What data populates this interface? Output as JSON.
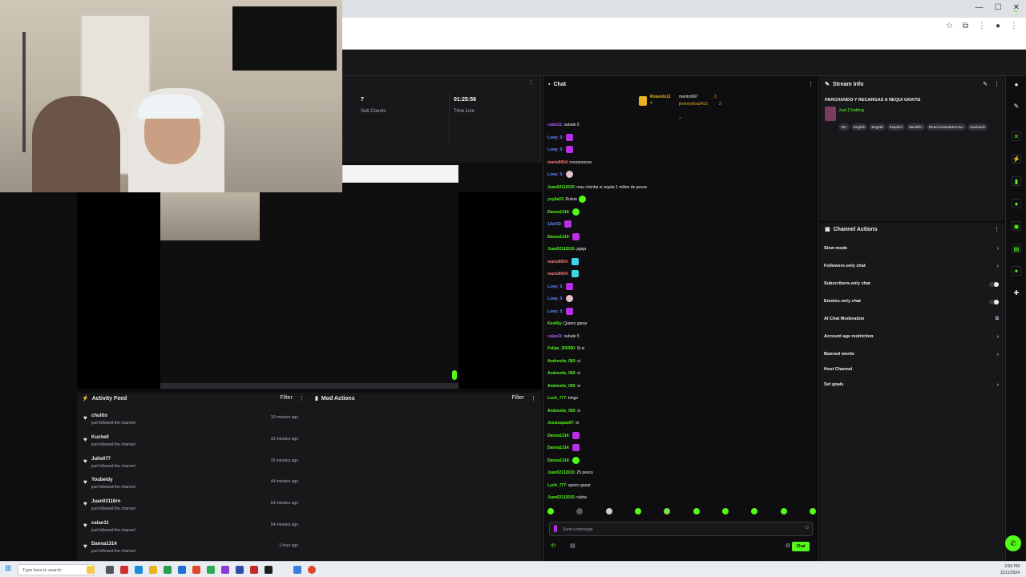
{
  "browser": {
    "window_controls": [
      "—",
      "☐",
      "✕"
    ]
  },
  "stats": {
    "sub_count_value": "7",
    "sub_count_label": "Sub Counts",
    "time_live_value": "01:25:56",
    "time_live_label": "Time Live"
  },
  "activity": {
    "title": "Activity Feed",
    "filter": "Filter",
    "items": [
      {
        "user": "chuitto",
        "desc": "just followed the channel",
        "time": "10 minutes ago"
      },
      {
        "user": "Kuchell",
        "desc": "just followed the channel",
        "time": "33 minutes ago"
      },
      {
        "user": "Julio077",
        "desc": "just followed the channel",
        "time": "35 minutes ago"
      },
      {
        "user": "Youbeidy",
        "desc": "just followed the channel",
        "time": "44 minutes ago"
      },
      {
        "user": "Juan03116rn",
        "desc": "just followed the channel",
        "time": "53 minutes ago"
      },
      {
        "user": "calao11",
        "desc": "just followed the channel",
        "time": "54 minutes ago"
      },
      {
        "user": "Danna1314",
        "desc": "just followed the channel",
        "time": "1 hour ago"
      }
    ]
  },
  "mod_actions": {
    "title": "Mod Actions",
    "filter": "Filter"
  },
  "chat": {
    "title": "Chat",
    "pinned": [
      {
        "user": "Rolando12",
        "count": "4",
        "user2": "mantro967",
        "n2": "3"
      },
      {
        "user2": "jhonnysilva2415",
        "n2": "2"
      }
    ],
    "messages": [
      {
        "user": "calao11",
        "color": "#b45cff",
        "msg": "subale 5",
        "emote": ""
      },
      {
        "user": "Lowy_5",
        "color": "#5b8cff",
        "msg": "",
        "emote": "purple"
      },
      {
        "user": "Lowy_5",
        "color": "#5b8cff",
        "msg": "",
        "emote": "purple"
      },
      {
        "user": "mario8054",
        "color": "#ff7a7a",
        "msg": "nooooooooo",
        "emote": ""
      },
      {
        "user": "Lowy_5",
        "color": "#5b8cff",
        "msg": "",
        "emote": "face"
      },
      {
        "user": "Juan02112015",
        "color": "#53fc18",
        "msg": "mas chimba si regala 1 millon de pesos",
        "emote": ""
      },
      {
        "user": "yoyila03",
        "color": "#53fc18",
        "msg": "Rulete",
        "emote": "green"
      },
      {
        "user": "Danna1314",
        "color": "#53fc18",
        "msg": "",
        "emote": "green"
      },
      {
        "user": "12e032",
        "color": "#5b8cff",
        "msg": "",
        "emote": "purple"
      },
      {
        "user": "Danna1314",
        "color": "#53fc18",
        "msg": "",
        "emote": "purple"
      },
      {
        "user": "Juan02112015",
        "color": "#53fc18",
        "msg": "jajaja",
        "emote": ""
      },
      {
        "user": "mario8054",
        "color": "#ff7a7a",
        "msg": "",
        "emote": "cyan"
      },
      {
        "user": "mario8054",
        "color": "#ff7a7a",
        "msg": "",
        "emote": "cyan"
      },
      {
        "user": "Lowy_5",
        "color": "#5b8cff",
        "msg": "",
        "emote": "purple"
      },
      {
        "user": "Lowy_5",
        "color": "#5b8cff",
        "msg": "",
        "emote": "face"
      },
      {
        "user": "Lowy_5",
        "color": "#5b8cff",
        "msg": "",
        "emote": "purple"
      },
      {
        "user": "Kev66y",
        "color": "#53fc18",
        "msg": "Quiero ganar",
        "emote": ""
      },
      {
        "user": "calao11",
        "color": "#b45cff",
        "msg": "subale 5",
        "emote": ""
      },
      {
        "user": "Felipe_305060",
        "color": "#53fc18",
        "msg": "Si si",
        "emote": ""
      },
      {
        "user": "Andresito_060",
        "color": "#53fc18",
        "msg": "si",
        "emote": ""
      },
      {
        "user": "Andresito_060",
        "color": "#53fc18",
        "msg": "si",
        "emote": ""
      },
      {
        "user": "Andresito_060",
        "color": "#53fc18",
        "msg": "si",
        "emote": ""
      },
      {
        "user": "Luch_777",
        "color": "#53fc18",
        "msg": "bingo",
        "emote": ""
      },
      {
        "user": "Andresito_060",
        "color": "#53fc18",
        "msg": "si",
        "emote": ""
      },
      {
        "user": "Jessicapao07",
        "color": "#53fc18",
        "msg": "si",
        "emote": ""
      },
      {
        "user": "Danna1314",
        "color": "#53fc18",
        "msg": "",
        "emote": "purple"
      },
      {
        "user": "Danna1314",
        "color": "#53fc18",
        "msg": "",
        "emote": "purple"
      },
      {
        "user": "Danna1314",
        "color": "#53fc18",
        "msg": "",
        "emote": "green"
      },
      {
        "user": "Juan02112015",
        "color": "#53fc18",
        "msg": "25 pesos",
        "emote": ""
      },
      {
        "user": "Luch_777",
        "color": "#53fc18",
        "msg": "quiero ganar",
        "emote": ""
      },
      {
        "user": "Juan02112015",
        "color": "#53fc18",
        "msg": "ruleta",
        "emote": ""
      }
    ],
    "input_placeholder": "Send a message",
    "send_label": "Chat"
  },
  "stream_info": {
    "title": "Stream Info",
    "stream_title": "PARCHANDO Y RECARGAS A NEQUI GRATIS",
    "category": "Just Chatting",
    "tags": [
      "18+",
      "English",
      "Bogotá",
      "Español",
      "Medellin",
      "ReaccionandoEnVivo",
      "charlando"
    ]
  },
  "channel_actions": {
    "title": "Channel Actions",
    "items": [
      {
        "label": "Slow mode",
        "ctrl": "chevron"
      },
      {
        "label": "Followers-only chat",
        "ctrl": "chevron"
      },
      {
        "label": "Subscribers-only chat",
        "ctrl": "toggle"
      },
      {
        "label": "Emotes-only chat",
        "ctrl": "toggle"
      },
      {
        "label": "AI Chat Moderation",
        "ctrl": "external"
      },
      {
        "label": "Account age restriction",
        "ctrl": "chevron"
      },
      {
        "label": "Banned words",
        "ctrl": "chevron"
      },
      {
        "label": "Host Channel",
        "ctrl": "none"
      },
      {
        "label": "Set goals",
        "ctrl": "chevron"
      }
    ]
  },
  "taskbar": {
    "search_placeholder": "Type here to search",
    "time": "3:56 PM",
    "date": "11/11/2024"
  },
  "colors": {
    "accent": "#53fc18",
    "bg": "#0e0e10",
    "panel": "#18181b"
  }
}
